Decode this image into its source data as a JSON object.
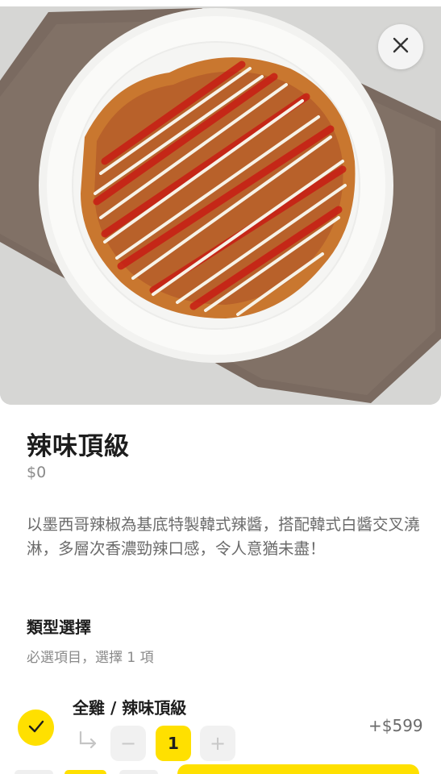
{
  "hero": {
    "image_name": "spicy-chicken-plate",
    "close_icon": "close-icon"
  },
  "product": {
    "title": "辣味頂級",
    "price": "$0",
    "description": "以墨西哥辣椒為基底特製韓式辣醬，搭配韓式白醬交叉澆淋，多層次香濃勁辣口感，令人意猶未盡！"
  },
  "options": {
    "section_title": "類型選擇",
    "section_subtitle": "必選項目，選擇 1 項",
    "items": [
      {
        "label": "全雞 / 辣味頂級",
        "price": "+$599",
        "selected": true,
        "quantity": "1",
        "minus_symbol": "−",
        "plus_symbol": "+"
      }
    ]
  },
  "colors": {
    "accent": "#ffe000",
    "text_primary": "#1d1d1d",
    "text_secondary": "#8a8a8a"
  }
}
